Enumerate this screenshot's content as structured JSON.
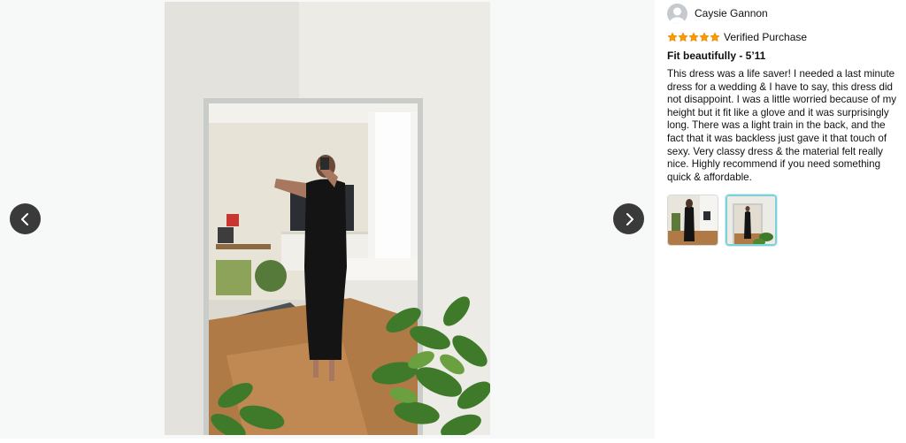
{
  "gallery": {
    "image_alt": "Customer photo of black halter maxi dress in mirror",
    "prev_icon": "chevron-left-icon",
    "next_icon": "chevron-right-icon"
  },
  "review": {
    "reviewer_name": "Caysie Gannon",
    "avatar_icon": "user-avatar-icon",
    "rating": 5,
    "rating_max": 5,
    "star_color": "#ff9900",
    "verified_label": "Verified Purchase",
    "title": "Fit beautifully - 5’11",
    "body": "This dress was a life saver! I needed a last minute dress for a wedding & I have to say, this dress did not disappoint. I was a little worried because of my height but it fit like a glove and it was surprisingly long. There was a light train in the back, and the fact that it was backless just gave it that touch of sexy. Very classy dress & the material felt really nice. Highly recommend if you need something quick & affordable.",
    "thumbnails": [
      {
        "label": "Back view photo",
        "selected": false
      },
      {
        "label": "Front view photo",
        "selected": true
      }
    ]
  },
  "colors": {
    "nav_button": "#3a3a3a",
    "selected_thumb_border": "#7fd1d9"
  }
}
